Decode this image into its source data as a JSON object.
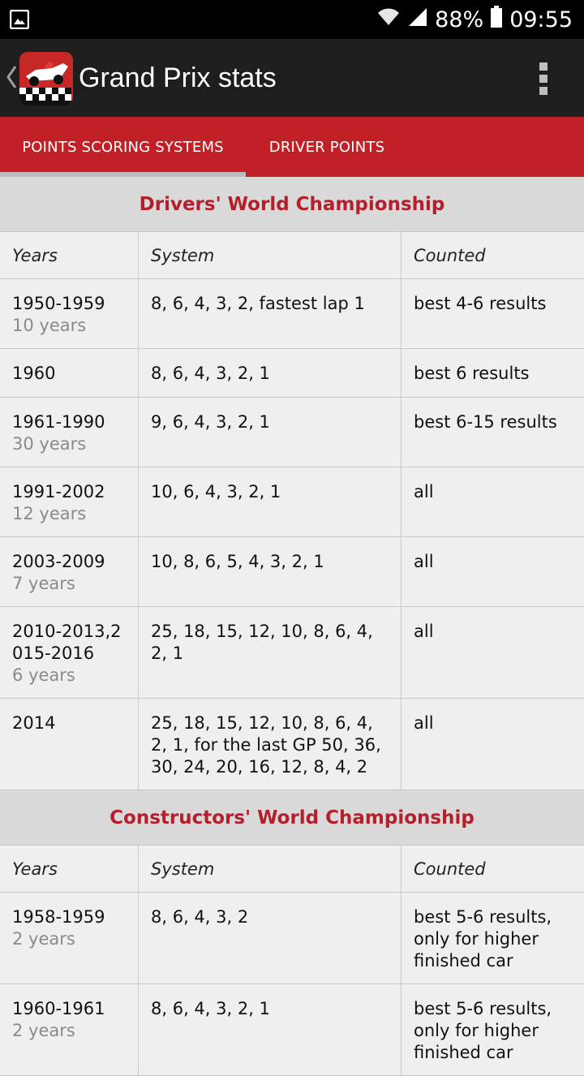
{
  "status": {
    "battery": "88%",
    "time": "09:55"
  },
  "app": {
    "title": "Grand Prix stats"
  },
  "tabs": [
    {
      "label": "POINTS SCORING SYSTEMS"
    },
    {
      "label": "DRIVER POINTS"
    }
  ],
  "drivers": {
    "title": "Drivers' World Championship",
    "headers": {
      "years": "Years",
      "system": "System",
      "counted": "Counted"
    },
    "rows": [
      {
        "years": "1950-1959",
        "span": "10 years",
        "system": "8, 6, 4, 3, 2, fastest lap 1",
        "counted": "best 4-6 results"
      },
      {
        "years": "1960",
        "span": "",
        "system": "8, 6, 4, 3, 2, 1",
        "counted": "best 6 results"
      },
      {
        "years": "1961-1990",
        "span": "30 years",
        "system": "9, 6, 4, 3, 2, 1",
        "counted": "best 6-15 results"
      },
      {
        "years": "1991-2002",
        "span": "12 years",
        "system": "10, 6, 4, 3, 2, 1",
        "counted": "all"
      },
      {
        "years": "2003-2009",
        "span": "7 years",
        "system": "10, 8, 6, 5, 4, 3, 2, 1",
        "counted": "all"
      },
      {
        "years": "2010-2013,2015-2016",
        "span": "6 years",
        "system": "25, 18, 15, 12, 10, 8, 6, 4, 2, 1",
        "counted": "all"
      },
      {
        "years": "2014",
        "span": "",
        "system": "25, 18, 15, 12, 10, 8, 6, 4, 2, 1, for the last GP 50, 36, 30, 24, 20, 16, 12, 8, 4, 2",
        "counted": "all"
      }
    ]
  },
  "constructors": {
    "title": "Constructors' World Championship",
    "headers": {
      "years": "Years",
      "system": "System",
      "counted": "Counted"
    },
    "rows": [
      {
        "years": "1958-1959",
        "span": "2 years",
        "system": "8, 6, 4, 3, 2",
        "counted": "best 5-6 results, only for higher finished car"
      },
      {
        "years": "1960-1961",
        "span": "2 years",
        "system": "8, 6, 4, 3, 2, 1",
        "counted": "best 5-6 results, only for higher finished car"
      }
    ]
  }
}
